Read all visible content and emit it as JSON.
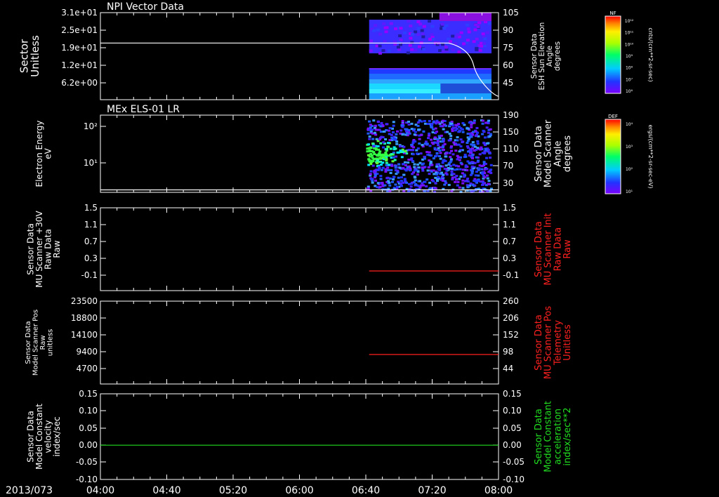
{
  "chart_data": [
    {
      "type": "heatmap",
      "title": "NPI Vector Data",
      "left_axis_label": [
        "Sector",
        "Unitless"
      ],
      "left_ticks": [
        "3.1e+01",
        "2.5e+01",
        "1.9e+01",
        "1.2e+01",
        "6.2e+00"
      ],
      "right_axis_label": [
        "Sensor Data",
        "ESH Sun Elevation",
        "Angle",
        "degrees"
      ],
      "right_ticks": [
        "105",
        "90",
        "75",
        "60",
        "45"
      ],
      "colorbar": {
        "label": "NF",
        "units": "cnts/(cm**2-sr-sec)",
        "ticks": [
          "10¹²",
          "10¹¹",
          "10¹⁰",
          "10⁹",
          "10⁸",
          "10⁷",
          "10⁶"
        ]
      },
      "line_series": {
        "name": "ESH Sun Elevation Angle",
        "color": "#ffffff",
        "x": [
          "04:00",
          "06:40",
          "07:30",
          "07:45",
          "08:00"
        ],
        "y": [
          79,
          79,
          79,
          60,
          34
        ]
      },
      "data_start": "06:42"
    },
    {
      "type": "heatmap",
      "title": "MEx ELS-01 LR",
      "left_axis_label": [
        "Electron Energy",
        "eV"
      ],
      "left_ticks": [
        "10²",
        "10¹"
      ],
      "right_axis_label": [
        "Sensor Data",
        "Model Scanner",
        "Angle",
        "degrees"
      ],
      "right_ticks": [
        "190",
        "150",
        "110",
        "70",
        "30"
      ],
      "colorbar": {
        "label": "DEF",
        "units": "ergs/(cm**2-sr-sec-eV)",
        "ticks": [
          "10⁴",
          "10³",
          "10²",
          "10¹"
        ]
      },
      "line_series": {
        "name": "Model Scanner Angle",
        "color": "#ffffff",
        "x": [
          "04:00",
          "08:00"
        ],
        "y": [
          14,
          14
        ]
      },
      "data_start": "06:40"
    },
    {
      "type": "line",
      "left_axis_label": [
        "Sensor Data",
        "MU Scanner +30V",
        "Raw Data",
        "Raw"
      ],
      "left_ticks": [
        "1.5",
        "1.1",
        "0.7",
        "0.3",
        "-0.1"
      ],
      "right_axis_label": [
        "Sensor Data",
        "MU Scanner Init",
        "Raw Data",
        "Raw"
      ],
      "right_ticks": [
        "1.5",
        "1.1",
        "0.7",
        "0.3",
        "-0.1"
      ],
      "ylim": [
        -0.4,
        1.5
      ],
      "series": [
        {
          "name": "MU Scanner Init Raw Data",
          "color": "#ff2020",
          "x": [
            "06:42",
            "08:00"
          ],
          "y": [
            0.0,
            0.0
          ]
        }
      ]
    },
    {
      "type": "line",
      "left_axis_label": [
        "Sensor Data",
        "Model Scanner Pos",
        "Raw",
        "unitless"
      ],
      "left_ticks": [
        "23500",
        "18800",
        "14100",
        "9400",
        "4700"
      ],
      "right_axis_label": [
        "Sensor Data",
        "MU Scanner Pos",
        "Telemetry",
        "Unitless"
      ],
      "right_ticks": [
        "260",
        "206",
        "152",
        "98",
        "44"
      ],
      "ylim": [
        0,
        23500
      ],
      "series": [
        {
          "name": "MU Scanner Pos Telemetry",
          "color": "#ff2020",
          "x": [
            "06:42",
            "08:00"
          ],
          "y": [
            89,
            89
          ]
        }
      ]
    },
    {
      "type": "line",
      "left_axis_label": [
        "Sensor Data",
        "Model Constant",
        "velocity",
        "index/sec"
      ],
      "left_ticks": [
        "0.15",
        "0.10",
        "0.05",
        "0.00",
        "-0.05",
        "-0.10"
      ],
      "right_axis_label": [
        "Sensor Data",
        "Model Constant",
        "acceleration",
        "index/sec**2"
      ],
      "right_ticks": [
        "0.15",
        "0.10",
        "0.05",
        "0.00",
        "-0.05",
        "-0.10"
      ],
      "ylim": [
        -0.1,
        0.15
      ],
      "series": [
        {
          "name": "Model Constant velocity",
          "color": "#20dd20",
          "x": [
            "04:00",
            "08:00"
          ],
          "y": [
            0.0,
            0.0
          ]
        }
      ]
    }
  ],
  "x_axis": {
    "date_label": "2013/073",
    "range": [
      "04:00",
      "08:00"
    ],
    "ticks": [
      "04:00",
      "04:40",
      "05:20",
      "06:00",
      "06:40",
      "07:20",
      "08:00"
    ]
  }
}
